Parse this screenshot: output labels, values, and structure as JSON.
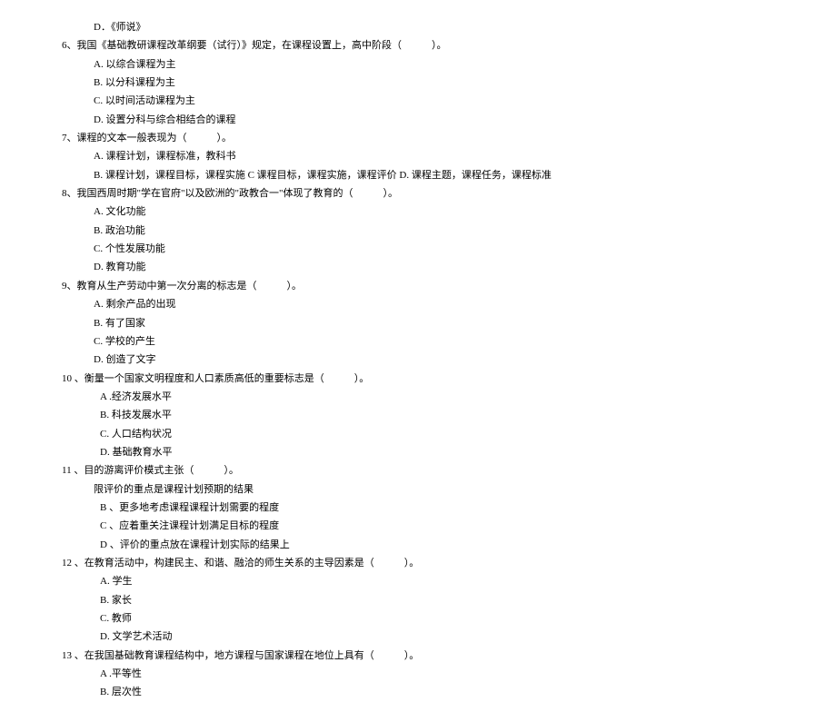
{
  "lines": [
    {
      "indent": 35,
      "text": "D．《师说》"
    },
    {
      "indent": 0,
      "text": "6、我国《基础教研课程改革纲要（试行）》规定，在课程设置上，高中阶段（　　　）。"
    },
    {
      "indent": 35,
      "text": "A. 以综合课程为主"
    },
    {
      "indent": 35,
      "text": "B. 以分科课程为主"
    },
    {
      "indent": 35,
      "text": "C. 以时间活动课程为主"
    },
    {
      "indent": 35,
      "text": "D. 设置分科与综合相结合的课程"
    },
    {
      "indent": 0,
      "text": "7、课程的文本一般表现为（　　　）。"
    },
    {
      "indent": 35,
      "text": "A. 课程计划，课程标准，教科书"
    },
    {
      "indent": 35,
      "text": "B. 课程计划，课程目标，课程实施 C 课程目标，课程实施，课程评价 D. 课程主题，课程任务，课程标准"
    },
    {
      "indent": 0,
      "text": "8、我国西周时期\"学在官府\"以及欧洲的\"政教合一\"体现了教育的（　　　）。"
    },
    {
      "indent": 35,
      "text": "A. 文化功能"
    },
    {
      "indent": 35,
      "text": "B. 政治功能"
    },
    {
      "indent": 35,
      "text": "C. 个性发展功能"
    },
    {
      "indent": 35,
      "text": "D. 教育功能"
    },
    {
      "indent": 0,
      "text": "9、教育从生产劳动中第一次分离的标志是（　　　）。"
    },
    {
      "indent": 35,
      "text": "A. 剩余产品的出现"
    },
    {
      "indent": 35,
      "text": "B. 有了国家"
    },
    {
      "indent": 35,
      "text": "C. 学校的产生"
    },
    {
      "indent": 35,
      "text": "D. 创造了文字"
    },
    {
      "indent": 0,
      "text": "10 、衡量一个国家文明程度和人口素质高低的重要标志是（　　　）。"
    },
    {
      "indent": 42,
      "text": "A .经济发展水平"
    },
    {
      "indent": 42,
      "text": "B. 科技发展水平"
    },
    {
      "indent": 42,
      "text": "C. 人口结构状况"
    },
    {
      "indent": 42,
      "text": "D. 基础教育水平"
    },
    {
      "indent": 0,
      "text": "11 、目的游离评价模式主张（　　　）。"
    },
    {
      "indent": 35,
      "text": "限评价的重点是课程计划预期的结果"
    },
    {
      "indent": 42,
      "text": "B 、更多地考虑课程课程计划需要的程度"
    },
    {
      "indent": 42,
      "text": "C 、应着重关注课程计划满足目标的程度"
    },
    {
      "indent": 42,
      "text": "D 、评价的重点放在课程计划实际的结果上"
    },
    {
      "indent": 0,
      "text": "12 、在教育活动中，构建民主、和谐、融洽的师生关系的主导因素是（　　　）。"
    },
    {
      "indent": 42,
      "text": "A. 学生"
    },
    {
      "indent": 42,
      "text": "B. 家长"
    },
    {
      "indent": 42,
      "text": "C. 教师"
    },
    {
      "indent": 42,
      "text": "D. 文学艺术活动"
    },
    {
      "indent": 0,
      "text": "13 、在我国基础教育课程结构中，地方课程与国家课程在地位上具有（　　　）。"
    },
    {
      "indent": 42,
      "text": "A .平等性"
    },
    {
      "indent": 42,
      "text": "B. 层次性"
    }
  ]
}
